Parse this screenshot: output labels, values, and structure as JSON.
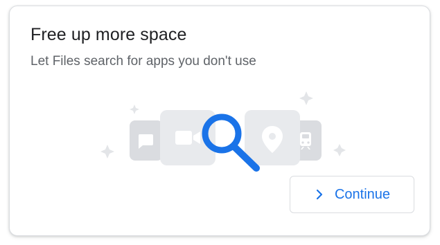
{
  "card": {
    "title": "Free up more space",
    "subtitle": "Let Files search for apps you don't use",
    "continue_label": "Continue"
  },
  "illustration": {
    "icons": [
      "chat-icon",
      "video-camera-icon",
      "search-icon",
      "location-pin-icon",
      "train-icon",
      "sparkle-icon"
    ]
  },
  "colors": {
    "accent": "#1a73e8",
    "title_text": "#202124",
    "subtitle_text": "#5f6368",
    "tile_light": "#e8eaed",
    "tile_dark": "#dadce0",
    "glyph": "#ffffff",
    "card_border": "#dadce0"
  }
}
